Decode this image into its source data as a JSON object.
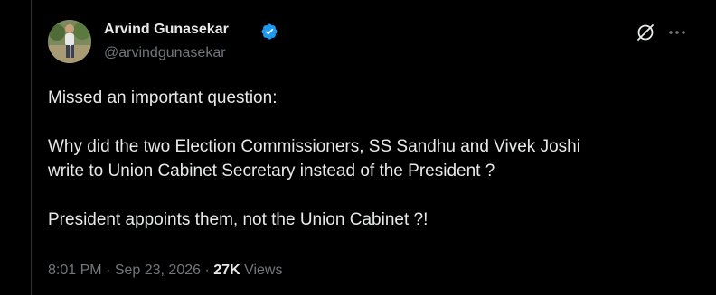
{
  "author": {
    "name": "Arvind Gunasekar",
    "handle": "@arvindgunasekar",
    "verified": true,
    "verified_color": "#1d9bf0"
  },
  "icons": {
    "verified": "verified-badge-icon",
    "grok": "grok-icon",
    "more": "more-options-icon"
  },
  "tweet": {
    "lines": {
      "line1": "Missed an important question:",
      "line2": "Why did the two Election Commissioners, SS Sandhu and Vivek Joshi",
      "line3": "write to Union Cabinet Secretary instead of the President ?",
      "line4": "President appoints them, not the Union Cabinet ?!"
    }
  },
  "meta": {
    "time": "8:01 PM",
    "sep": "·",
    "date": "Sep 23, 2026",
    "views_count": "27K",
    "views_label": "Views"
  },
  "colors": {
    "background": "#000000",
    "text": "#e7e9ea",
    "secondary": "#71767b",
    "border": "#2f3336"
  }
}
